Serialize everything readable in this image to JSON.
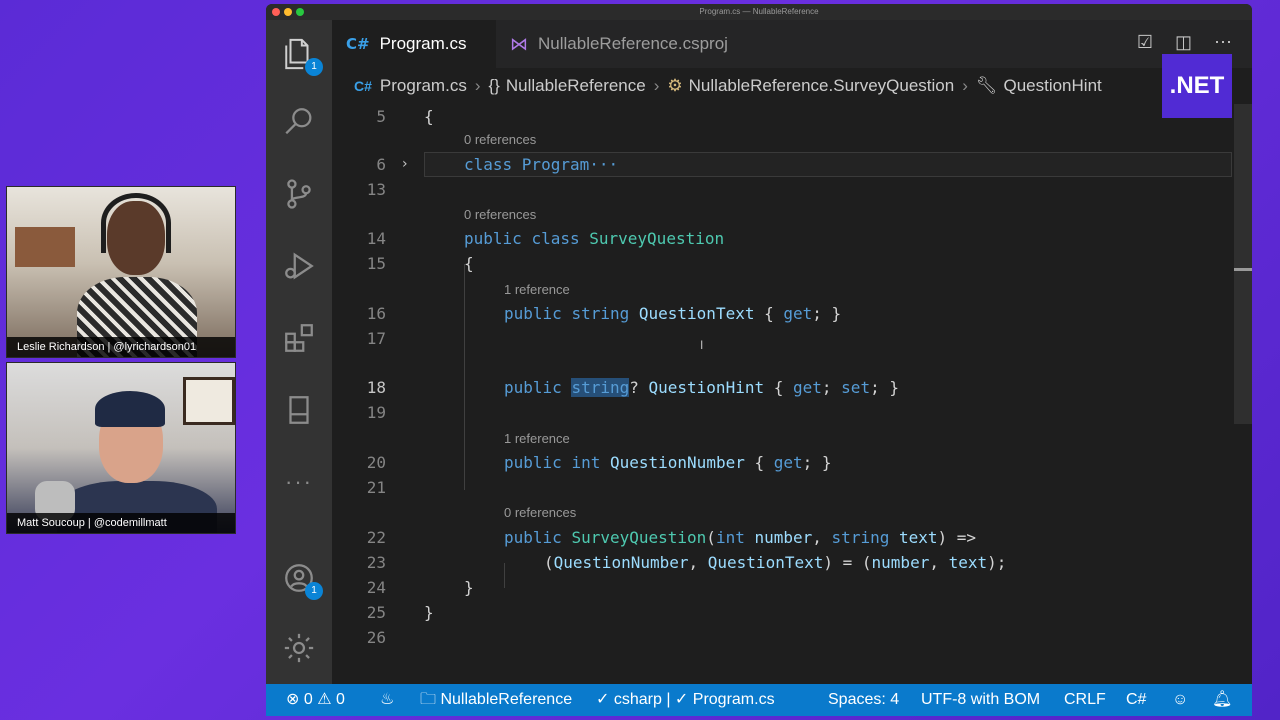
{
  "participants": [
    {
      "name": "Leslie Richardson | @lyrichardson01"
    },
    {
      "name": "Matt Soucoup | @codemillmatt"
    }
  ],
  "window": {
    "title": "Program.cs — NullableReference"
  },
  "activity_bar": {
    "explorer_badge": "1",
    "accounts_badge": "1"
  },
  "tabs": [
    {
      "icon": "C#",
      "label": "Program.cs",
      "modified": true
    },
    {
      "icon": "vs-logo",
      "label": "NullableReference.csproj"
    }
  ],
  "breadcrumb": {
    "file_icon": "C#",
    "file": "Program.cs",
    "namespace_icon": "{}",
    "namespace": "NullableReference",
    "class": "NullableReference.SurveyQuestion",
    "property": "QuestionHint"
  },
  "brand_logo": ".NET",
  "code": {
    "lines": [
      {
        "num": "5",
        "text": "{"
      },
      {
        "num": "6",
        "text": "class Program···",
        "lens": "0 references"
      },
      {
        "num": "13",
        "text": ""
      },
      {
        "num": "14",
        "text": "public class SurveyQuestion",
        "lens": "0 references"
      },
      {
        "num": "15",
        "text": "{"
      },
      {
        "num": "16",
        "text": "public string QuestionText { get; }",
        "lens": "1 reference"
      },
      {
        "num": "17",
        "text": ""
      },
      {
        "num": "18",
        "text": "public string? QuestionHint { get; set; }"
      },
      {
        "num": "19",
        "text": ""
      },
      {
        "num": "20",
        "text": "public int QuestionNumber { get; }",
        "lens": "1 reference"
      },
      {
        "num": "21",
        "text": ""
      },
      {
        "num": "22",
        "text": "public SurveyQuestion(int number, string text) =>",
        "lens": "0 references"
      },
      {
        "num": "23",
        "text": "(QuestionNumber, QuestionText) = (number, text);"
      },
      {
        "num": "24",
        "text": "}"
      },
      {
        "num": "25",
        "text": "}"
      },
      {
        "num": "26",
        "text": ""
      }
    ]
  },
  "status_bar": {
    "errors": "0",
    "warnings": "0",
    "project": "NullableReference",
    "language_server": "csharp | ✓ Program.cs",
    "spaces": "Spaces: 4",
    "encoding": "UTF-8 with BOM",
    "eol": "CRLF",
    "language": "C#"
  },
  "colors": {
    "accent": "#0a7acc",
    "dotnet": "#512bd4",
    "keyword": "#569cd6",
    "type": "#4ec9b0"
  }
}
